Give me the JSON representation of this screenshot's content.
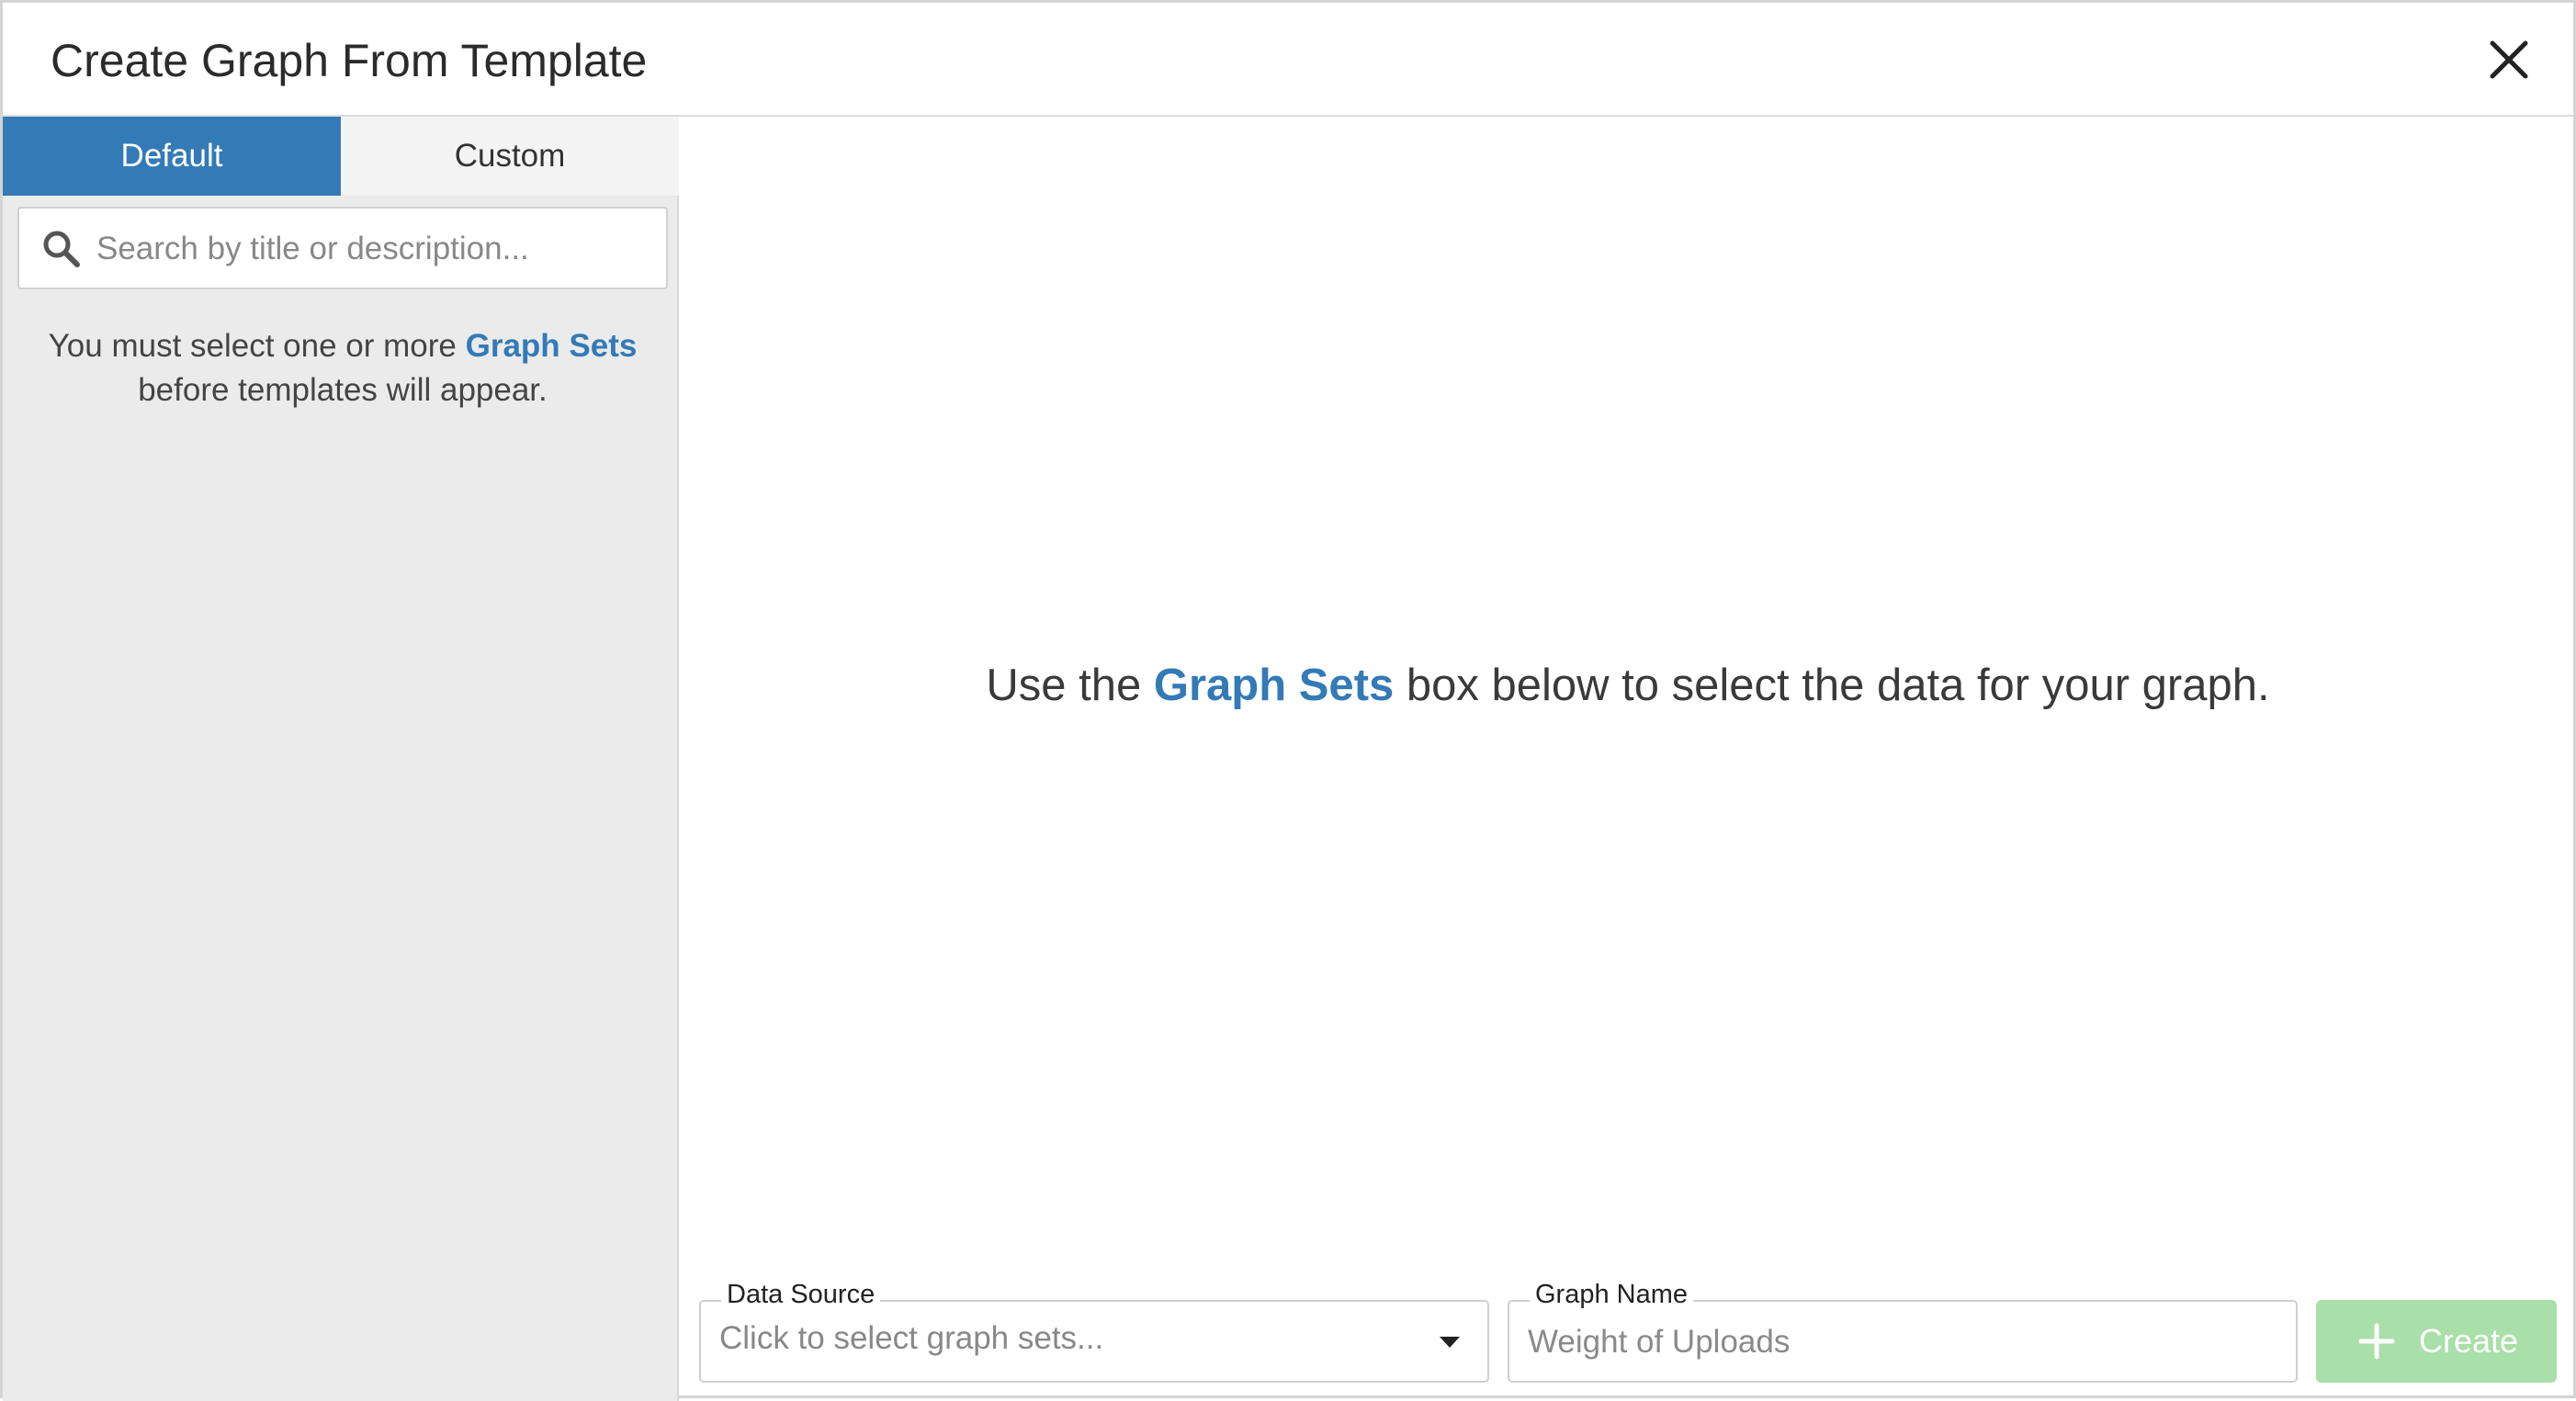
{
  "dialog": {
    "title": "Create Graph From Template",
    "close_icon": "close-icon"
  },
  "sidebar": {
    "tabs": [
      {
        "label": "Default",
        "active": true
      },
      {
        "label": "Custom",
        "active": false
      }
    ],
    "search": {
      "placeholder": "Search by title or description...",
      "value": "",
      "icon": "search-icon"
    },
    "message": {
      "before_link": "You must select one or more ",
      "link": "Graph Sets",
      "after_link": "before templates will appear."
    }
  },
  "main": {
    "message": {
      "before_link": "Use the ",
      "link": "Graph Sets",
      "after_link": " box below to select the data for your graph."
    }
  },
  "footer": {
    "data_source": {
      "label": "Data Source",
      "placeholder": "Click to select graph sets...",
      "icon": "chevron-down-icon"
    },
    "graph_name": {
      "label": "Graph Name",
      "placeholder": "Weight of Uploads",
      "value": ""
    },
    "create_button": {
      "label": "Create",
      "icon": "plus-icon",
      "enabled": false
    }
  },
  "colors": {
    "accent": "#337ab7",
    "create_disabled": "#a9dfa9",
    "sidebar_bg": "#ebebeb"
  }
}
